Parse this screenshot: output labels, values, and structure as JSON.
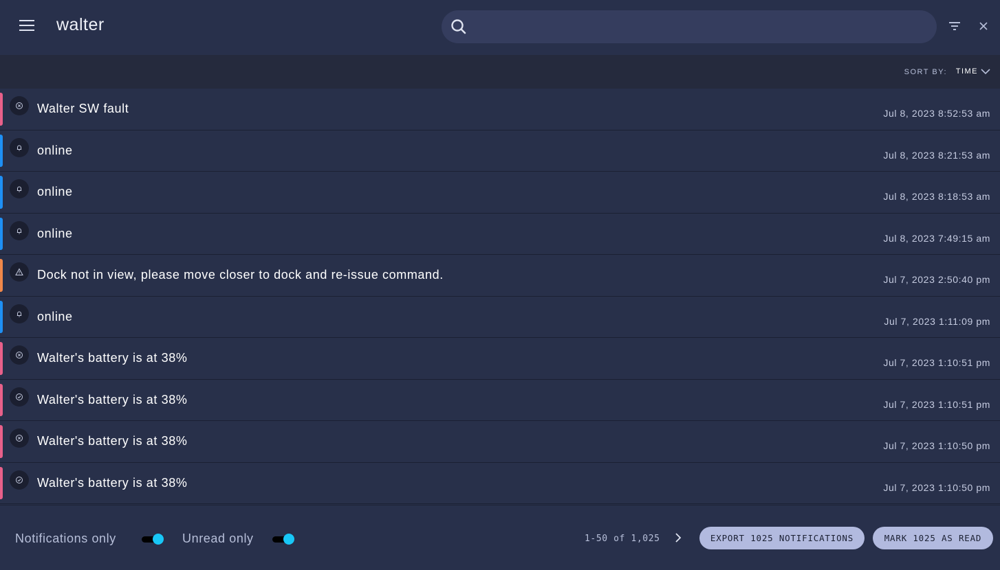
{
  "header": {
    "title": "walter",
    "search_value": "",
    "search_placeholder": ""
  },
  "sort": {
    "label": "SORT BY:",
    "value": "TIME"
  },
  "colors": {
    "error": "#e8608a",
    "info": "#1e90f5",
    "warning": "#f0884a",
    "toggle_on": "#18c7f7"
  },
  "notifications": [
    {
      "message": "Walter SW fault",
      "time": "Jul 8, 2023 8:52:53 am",
      "level": "error",
      "icon": "x-circle-icon"
    },
    {
      "message": "online",
      "time": "Jul 8, 2023 8:21:53 am",
      "level": "info",
      "icon": "bell-icon"
    },
    {
      "message": "online",
      "time": "Jul 8, 2023 8:18:53 am",
      "level": "info",
      "icon": "bell-icon"
    },
    {
      "message": "online",
      "time": "Jul 8, 2023 7:49:15 am",
      "level": "info",
      "icon": "bell-icon"
    },
    {
      "message": "Dock not in view, please move closer to dock and re-issue command.",
      "time": "Jul 7, 2023 2:50:40 pm",
      "level": "warning",
      "icon": "warning-icon"
    },
    {
      "message": "online",
      "time": "Jul 7, 2023 1:11:09 pm",
      "level": "info",
      "icon": "bell-icon"
    },
    {
      "message": "Walter's battery is at 38%",
      "time": "Jul 7, 2023 1:10:51 pm",
      "level": "error",
      "icon": "x-circle-icon"
    },
    {
      "message": "Walter's battery is at 38%",
      "time": "Jul 7, 2023 1:10:51 pm",
      "level": "error",
      "icon": "check-circle-icon"
    },
    {
      "message": "Walter's battery is at 38%",
      "time": "Jul 7, 2023 1:10:50 pm",
      "level": "error",
      "icon": "x-circle-icon"
    },
    {
      "message": "Walter's battery is at 38%",
      "time": "Jul 7, 2023 1:10:50 pm",
      "level": "error",
      "icon": "check-circle-icon"
    }
  ],
  "footer": {
    "notifications_only_label": "Notifications only",
    "notifications_only": true,
    "unread_only_label": "Unread only",
    "unread_only": true,
    "pagination": "1-50 of 1,025",
    "export_label": "EXPORT 1025 NOTIFICATIONS",
    "mark_read_label": "MARK 1025 AS READ"
  }
}
